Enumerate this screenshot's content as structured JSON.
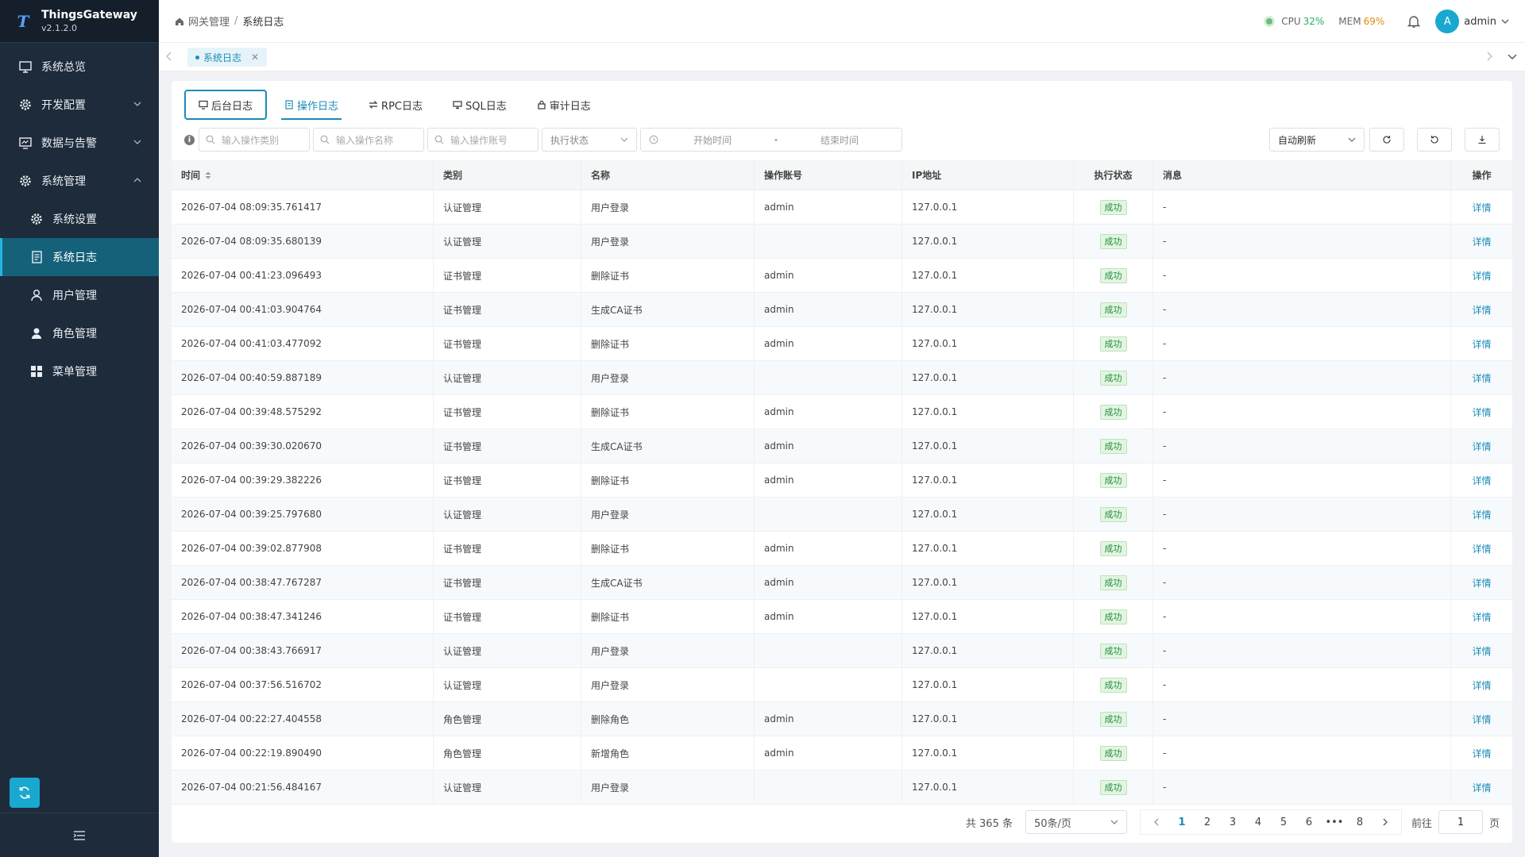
{
  "brand": {
    "name": "ThingsGateway",
    "version": "v2.1.2.0"
  },
  "sidebar": {
    "items": [
      {
        "label": "系统总览",
        "icon": "monitor-icon"
      },
      {
        "label": "开发配置",
        "icon": "gear-icon"
      },
      {
        "label": "数据与告警",
        "icon": "chart-monitor-icon"
      },
      {
        "label": "系统管理",
        "icon": "gear-icon"
      },
      {
        "label": "系统设置",
        "icon": "gear-icon"
      },
      {
        "label": "系统日志",
        "icon": "document-icon"
      },
      {
        "label": "用户管理",
        "icon": "user-icon"
      },
      {
        "label": "角色管理",
        "icon": "person-icon"
      },
      {
        "label": "菜单管理",
        "icon": "grid-icon"
      }
    ]
  },
  "header": {
    "breadcrumb": [
      "网关管理",
      "系统日志"
    ],
    "cpu_label": "CPU",
    "cpu_value": "32%",
    "mem_label": "MEM",
    "mem_value": "69%",
    "avatar_letter": "A",
    "username": "admin"
  },
  "tabs": {
    "open": [
      "系统日志"
    ]
  },
  "subtabs": [
    "后台日志",
    "操作日志",
    "RPC日志",
    "SQL日志",
    "审计日志"
  ],
  "filters": {
    "category_placeholder": "输入操作类别",
    "name_placeholder": "输入操作名称",
    "account_placeholder": "输入操作账号",
    "status_placeholder": "执行状态",
    "start_placeholder": "开始时间",
    "date_sep": "-",
    "end_placeholder": "结束时间",
    "auto_refresh": "自动刷新"
  },
  "table": {
    "columns": [
      "时间",
      "类别",
      "名称",
      "操作账号",
      "IP地址",
      "执行状态",
      "消息",
      "操作"
    ],
    "rows": [
      [
        "2026-07-04 08:09:35.761417",
        "认证管理",
        "用户登录",
        "admin",
        "127.0.0.1",
        "成功",
        "-",
        "详情"
      ],
      [
        "2026-07-04 08:09:35.680139",
        "认证管理",
        "用户登录",
        "",
        "127.0.0.1",
        "成功",
        "-",
        "详情"
      ],
      [
        "2026-07-04 00:41:23.096493",
        "证书管理",
        "删除证书",
        "admin",
        "127.0.0.1",
        "成功",
        "-",
        "详情"
      ],
      [
        "2026-07-04 00:41:03.904764",
        "证书管理",
        "生成CA证书",
        "admin",
        "127.0.0.1",
        "成功",
        "-",
        "详情"
      ],
      [
        "2026-07-04 00:41:03.477092",
        "证书管理",
        "删除证书",
        "admin",
        "127.0.0.1",
        "成功",
        "-",
        "详情"
      ],
      [
        "2026-07-04 00:40:59.887189",
        "认证管理",
        "用户登录",
        "",
        "127.0.0.1",
        "成功",
        "-",
        "详情"
      ],
      [
        "2026-07-04 00:39:48.575292",
        "证书管理",
        "删除证书",
        "admin",
        "127.0.0.1",
        "成功",
        "-",
        "详情"
      ],
      [
        "2026-07-04 00:39:30.020670",
        "证书管理",
        "生成CA证书",
        "admin",
        "127.0.0.1",
        "成功",
        "-",
        "详情"
      ],
      [
        "2026-07-04 00:39:29.382226",
        "证书管理",
        "删除证书",
        "admin",
        "127.0.0.1",
        "成功",
        "-",
        "详情"
      ],
      [
        "2026-07-04 00:39:25.797680",
        "认证管理",
        "用户登录",
        "",
        "127.0.0.1",
        "成功",
        "-",
        "详情"
      ],
      [
        "2026-07-04 00:39:02.877908",
        "证书管理",
        "删除证书",
        "admin",
        "127.0.0.1",
        "成功",
        "-",
        "详情"
      ],
      [
        "2026-07-04 00:38:47.767287",
        "证书管理",
        "生成CA证书",
        "admin",
        "127.0.0.1",
        "成功",
        "-",
        "详情"
      ],
      [
        "2026-07-04 00:38:47.341246",
        "证书管理",
        "删除证书",
        "admin",
        "127.0.0.1",
        "成功",
        "-",
        "详情"
      ],
      [
        "2026-07-04 00:38:43.766917",
        "认证管理",
        "用户登录",
        "",
        "127.0.0.1",
        "成功",
        "-",
        "详情"
      ],
      [
        "2026-07-04 00:37:56.516702",
        "认证管理",
        "用户登录",
        "",
        "127.0.0.1",
        "成功",
        "-",
        "详情"
      ],
      [
        "2026-07-04 00:22:27.404558",
        "角色管理",
        "删除角色",
        "admin",
        "127.0.0.1",
        "成功",
        "-",
        "详情"
      ],
      [
        "2026-07-04 00:22:19.890490",
        "角色管理",
        "新增角色",
        "admin",
        "127.0.0.1",
        "成功",
        "-",
        "详情"
      ],
      [
        "2026-07-04 00:21:56.484167",
        "认证管理",
        "用户登录",
        "",
        "127.0.0.1",
        "成功",
        "-",
        "详情"
      ]
    ]
  },
  "pagination": {
    "total": "共 365 条",
    "page_size": "50条/页",
    "pages": [
      "1",
      "2",
      "3",
      "4",
      "5",
      "6",
      "•••",
      "8"
    ],
    "current": "1",
    "goto_label": "前往",
    "goto_value": "1",
    "goto_suffix": "页"
  },
  "colors": {
    "accent": "#1a8cb8",
    "sidebar_bg": "#1e2b3a",
    "success": "#1e8e3e",
    "cpu": "#27ae60",
    "mem": "#e08e0b"
  }
}
